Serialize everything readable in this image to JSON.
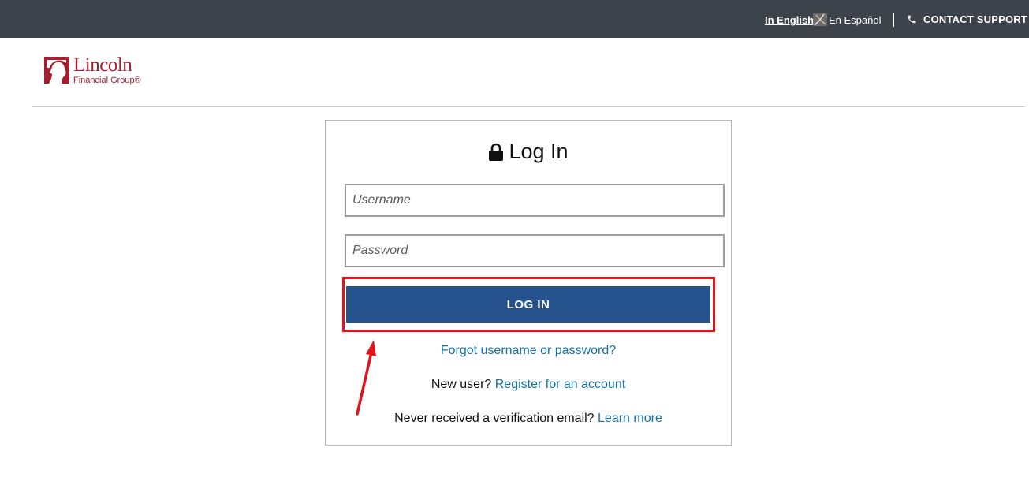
{
  "topbar": {
    "lang_english": "In English",
    "lang_spanish": "En Español",
    "contact_label": "CONTACT SUPPORT"
  },
  "logo": {
    "name": "Lincoln",
    "subtitle": "Financial Group®"
  },
  "login": {
    "title": "Log In",
    "username_placeholder": "Username",
    "password_placeholder": "Password",
    "button_label": "LOG IN",
    "forgot_link": "Forgot username or password?",
    "new_user_text": "New user?",
    "register_link": "Register for an account",
    "verify_text": "Never received a verification email?",
    "learn_more_link": "Learn more"
  },
  "colors": {
    "topbar": "#3c434a",
    "brand": "#a31e2e",
    "button": "#25518c",
    "link": "#1473a6",
    "annotation": "#e1141e"
  },
  "icons": [
    "lock-icon",
    "phone-icon",
    "language-toggle-icon",
    "annotation-arrow"
  ]
}
